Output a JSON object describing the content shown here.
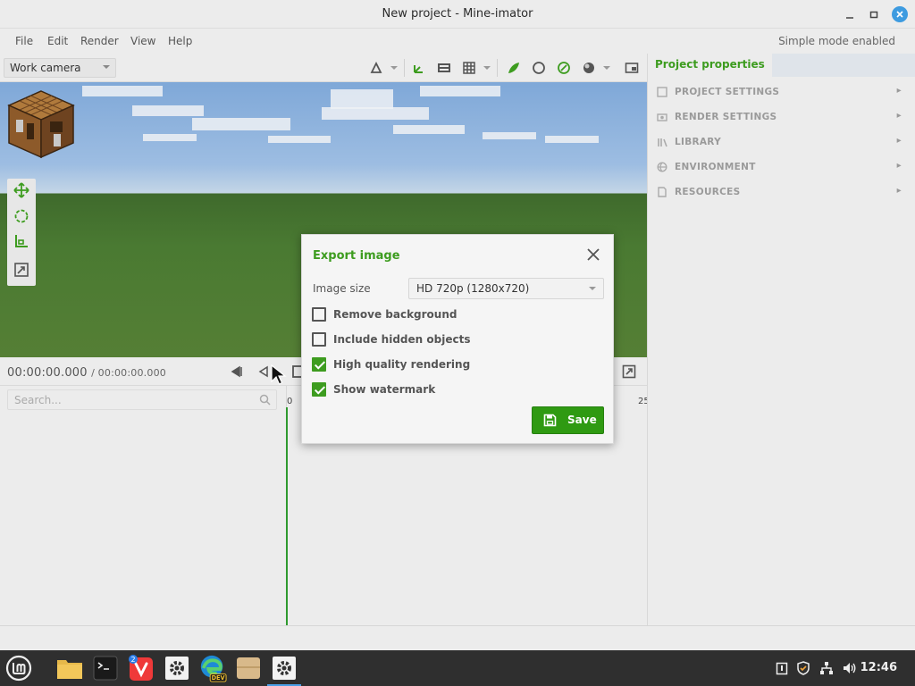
{
  "window": {
    "title": "New project - Mine-imator"
  },
  "menubar": {
    "items": [
      "File",
      "Edit",
      "Render",
      "View",
      "Help"
    ],
    "simple_mode": "Simple mode enabled"
  },
  "toolbar": {
    "camera_select": "Work camera"
  },
  "timeline": {
    "current_time": "00:00:00.000",
    "total_time": "/ 00:00:00.000",
    "search_placeholder": "Search...",
    "ruler_start": "0",
    "ruler_end": "25"
  },
  "right_panel": {
    "tab_label": "Project properties",
    "items": [
      {
        "label": "PROJECT SETTINGS",
        "icon": "document-icon"
      },
      {
        "label": "RENDER SETTINGS",
        "icon": "camera-icon"
      },
      {
        "label": "LIBRARY",
        "icon": "library-icon"
      },
      {
        "label": "ENVIRONMENT",
        "icon": "globe-icon"
      },
      {
        "label": "RESOURCES",
        "icon": "file-icon"
      }
    ]
  },
  "dialog": {
    "title": "Export image",
    "image_size_label": "Image size",
    "image_size_value": "HD 720p (1280x720)",
    "options": [
      {
        "label": "Remove background",
        "checked": false
      },
      {
        "label": "Include hidden objects",
        "checked": false
      },
      {
        "label": "High quality rendering",
        "checked": true
      },
      {
        "label": "Show watermark",
        "checked": true
      }
    ],
    "save_label": "Save"
  },
  "taskbar": {
    "apps": [
      "mint-menu",
      "files",
      "terminal",
      "vivaldi",
      "settings",
      "edge-dev",
      "archive",
      "mine-imator"
    ],
    "vivaldi_badge": "2",
    "edge_badge": "DEV",
    "clock": "12:46"
  },
  "colors": {
    "accent_green": "#3d9c1f",
    "save_button": "#2f9a12",
    "taskbar_bg": "#2f2f2f",
    "close_button": "#3d9be0"
  }
}
